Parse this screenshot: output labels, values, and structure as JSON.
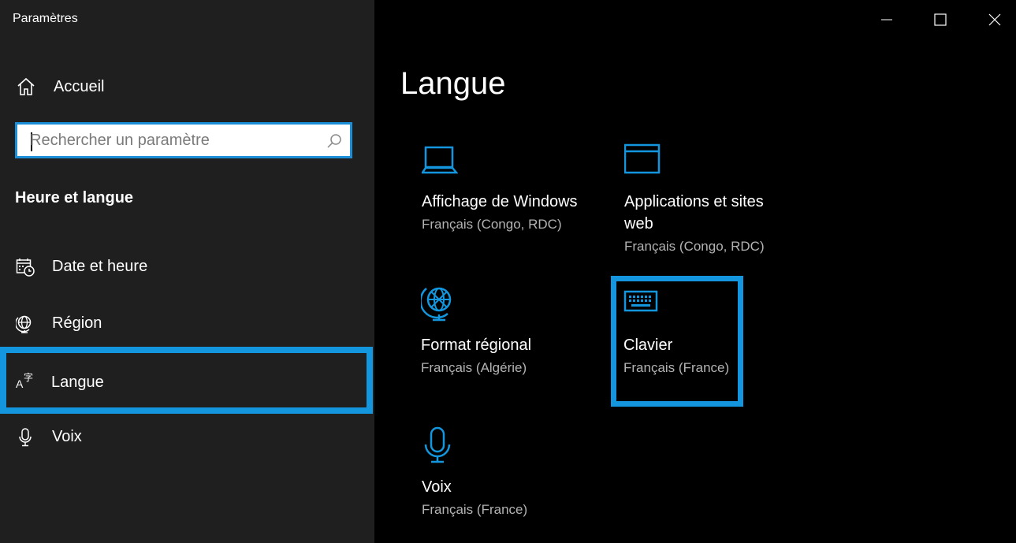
{
  "window": {
    "title": "Paramètres",
    "controls": {
      "minimize": "minimize",
      "maximize": "maximize",
      "close": "close"
    }
  },
  "sidebar": {
    "home_label": "Accueil",
    "search": {
      "placeholder": "Rechercher un paramètre",
      "value": ""
    },
    "section_title": "Heure et langue",
    "items": [
      {
        "label": "Date et heure",
        "icon": "calendar-clock-icon",
        "selected": false
      },
      {
        "label": "Région",
        "icon": "globe-icon",
        "selected": false
      },
      {
        "label": "Langue",
        "icon": "language-icon",
        "selected": true
      },
      {
        "label": "Voix",
        "icon": "microphone-icon",
        "selected": false
      }
    ]
  },
  "main": {
    "title": "Langue",
    "tiles": [
      {
        "title": "Affichage de Windows",
        "subtitle": "Français (Congo, RDC)",
        "icon": "laptop-icon"
      },
      {
        "title_line1": "Applications et sites",
        "title_line2": "web",
        "subtitle": "Français (Congo, RDC)",
        "icon": "window-icon"
      },
      {
        "title": "Format régional",
        "subtitle": "Français (Algérie)",
        "icon": "globe-stand-icon"
      },
      {
        "title": "Clavier",
        "subtitle": "Français (France)",
        "icon": "keyboard-icon",
        "highlighted": true
      },
      {
        "title": "Voix",
        "subtitle": "Français (France)",
        "icon": "microphone-icon"
      }
    ]
  },
  "colors": {
    "accent": "#1396dd",
    "sidebar_bg": "#1f1f1f",
    "main_bg": "#000000",
    "subtext": "#b3b3b3"
  }
}
